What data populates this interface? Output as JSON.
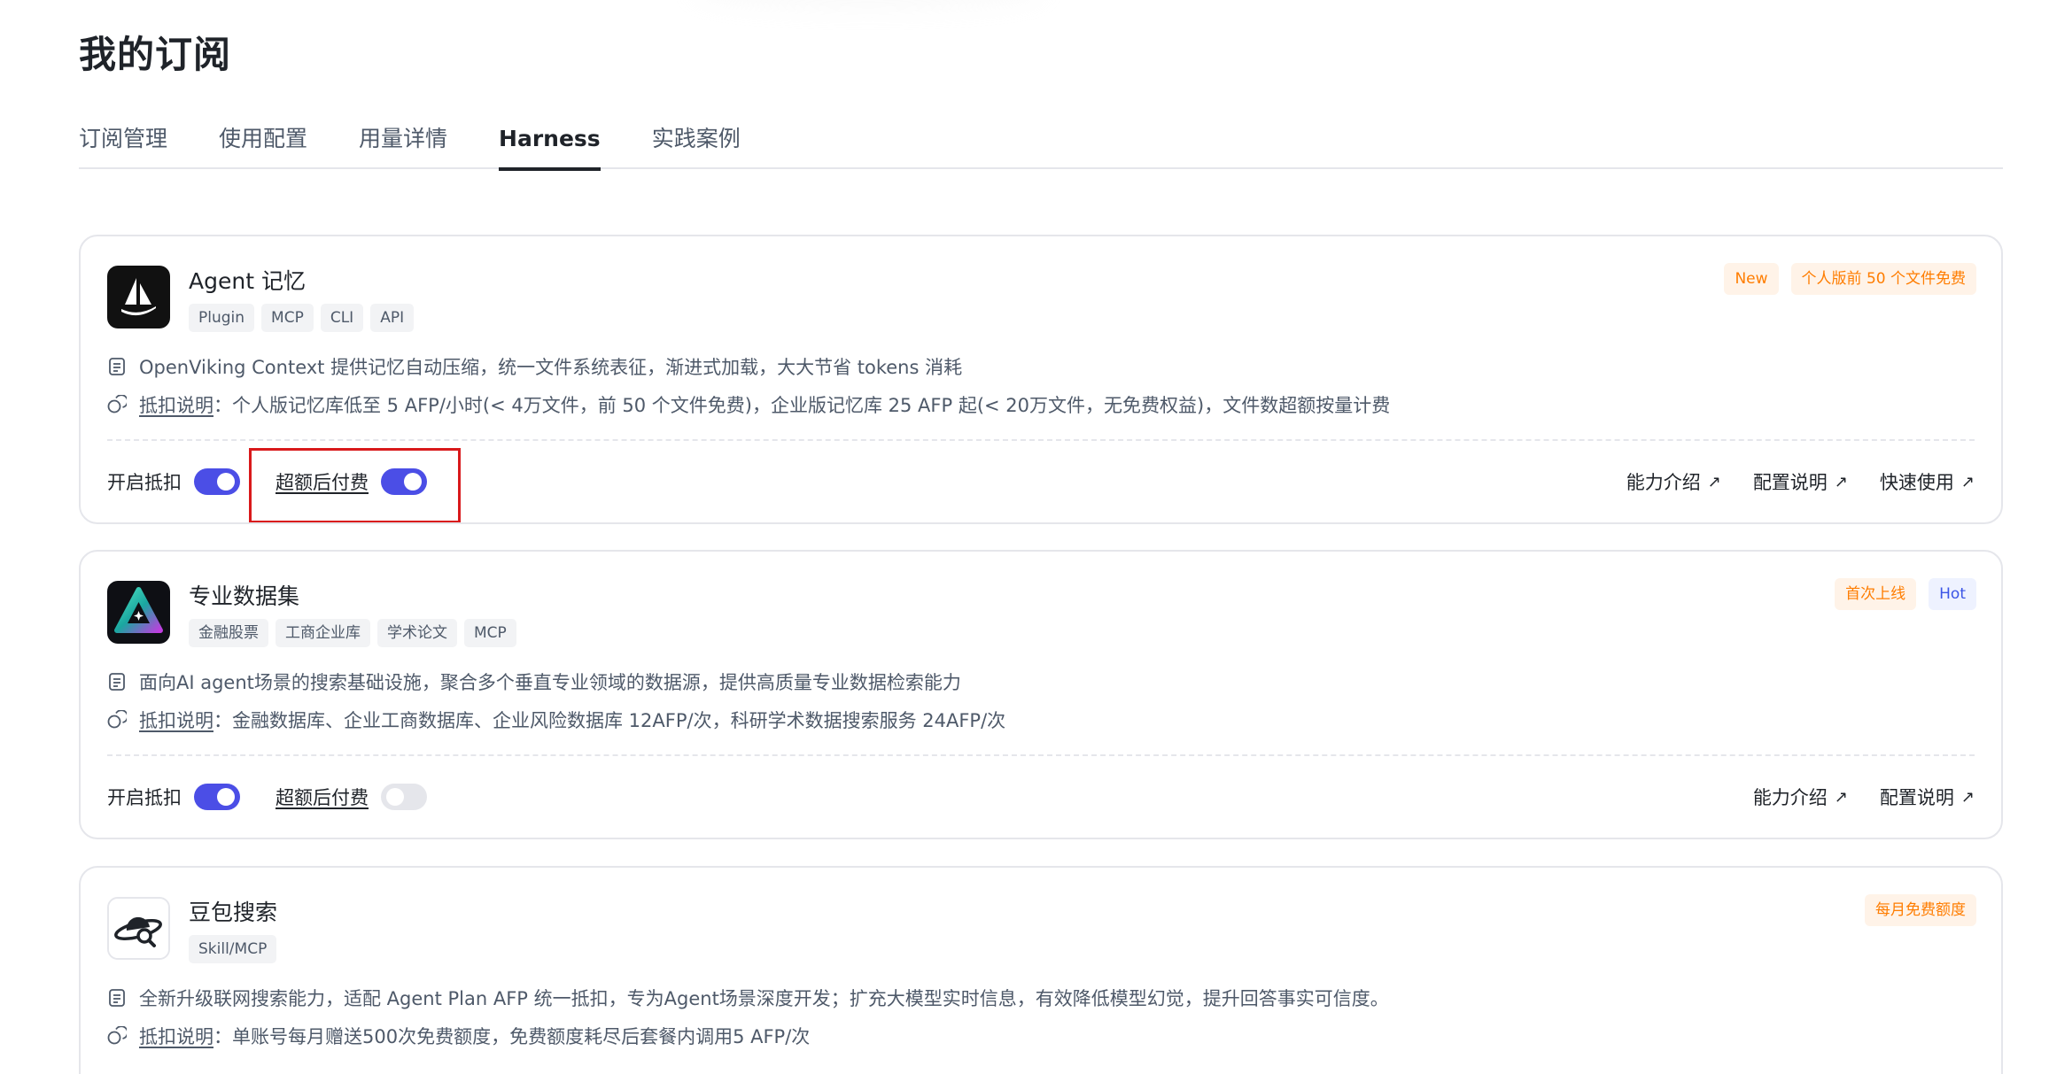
{
  "page_title": "我的订阅",
  "tabs": [
    {
      "label": "订阅管理",
      "active": false
    },
    {
      "label": "使用配置",
      "active": false
    },
    {
      "label": "用量详情",
      "active": false
    },
    {
      "label": "Harness",
      "active": true
    },
    {
      "label": "实践案例",
      "active": false
    }
  ],
  "colors": {
    "accent": "#4b4ee6",
    "badge_orange": "#ff7d00",
    "badge_blue": "#3b55e6",
    "highlight": "#d9191b"
  },
  "cards": [
    {
      "title": "Agent 记忆",
      "tags": [
        "Plugin",
        "MCP",
        "CLI",
        "API"
      ],
      "badges": [
        "New",
        "个人版前 50 个文件免费"
      ],
      "description": "OpenViking Context 提供记忆自动压缩，统一文件系统表征，渐进式加载，大大节省 tokens 消耗",
      "deduct_link": "抵扣说明",
      "deduct_text": "：个人版记忆库低至 5 AFP/小时(< 4万文件，前 50 个文件免费)，企业版记忆库 25 AFP 起(< 20万文件，无免费权益)，文件数超额按量计费",
      "toggle1_label": "开启抵扣",
      "toggle1_on": true,
      "toggle2_label": "超额后付费",
      "toggle2_on": true,
      "links": [
        "能力介绍",
        "配置说明",
        "快速使用"
      ],
      "icon": "sailboat-logo"
    },
    {
      "title": "专业数据集",
      "tags": [
        "金融股票",
        "工商企业库",
        "学术论文",
        "MCP"
      ],
      "badges": [
        "首次上线",
        "Hot"
      ],
      "description": "面向AI agent场景的搜索基础设施，聚合多个垂直专业领域的数据源，提供高质量专业数据检索能力",
      "deduct_link": "抵扣说明",
      "deduct_text": "：金融数据库、企业工商数据库、企业风险数据库 12AFP/次，科研学术数据搜索服务 24AFP/次",
      "toggle1_label": "开启抵扣",
      "toggle1_on": true,
      "toggle2_label": "超额后付费",
      "toggle2_on": false,
      "links": [
        "能力介绍",
        "配置说明"
      ],
      "icon": "gradient-triangle-logo"
    },
    {
      "title": "豆包搜索",
      "tags": [
        "Skill/MCP"
      ],
      "badges": [
        "每月免费额度"
      ],
      "description": "全新升级联网搜索能力，适配 Agent Plan AFP 统一抵扣，专为Agent场景深度开发；扩充大模型实时信息，有效降低模型幻觉，提升回答事实可信度。",
      "deduct_link": "抵扣说明",
      "deduct_text": "：单账号每月赠送500次免费额度，免费额度耗尽后套餐内调用5 AFP/次",
      "icon": "planet-search-logo"
    }
  ],
  "arrow_glyph": "↗"
}
